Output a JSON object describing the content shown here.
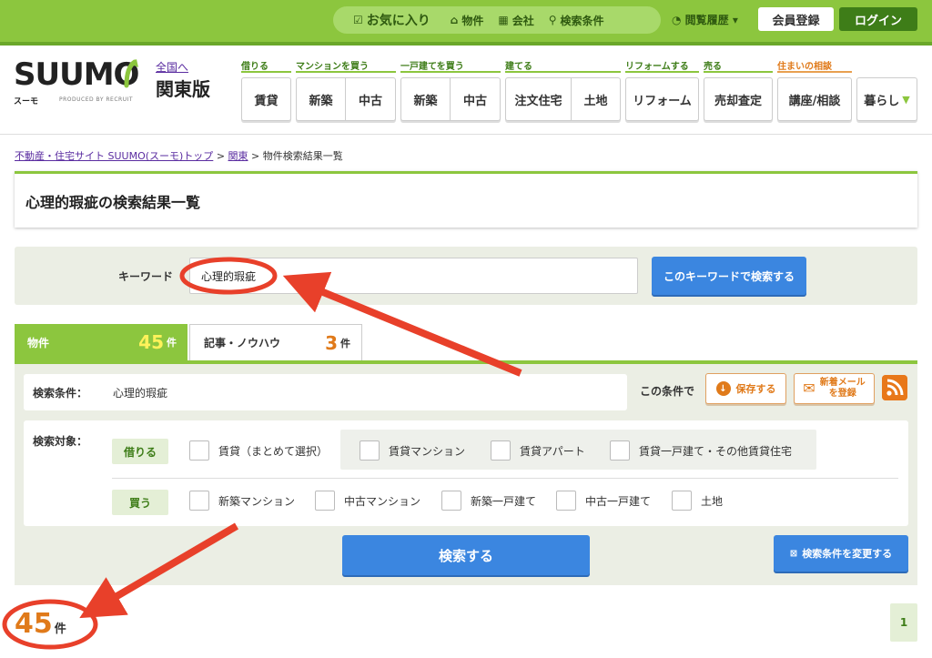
{
  "topbar": {
    "favorites": "お気に入り",
    "links": [
      "物件",
      "会社",
      "検索条件"
    ],
    "history": "閲覧履歴",
    "register": "会員登録",
    "login": "ログイン"
  },
  "header": {
    "logo_text": "SUUMO",
    "logo_sub": "スーモ",
    "logo_produced": "PRODUCED BY RECRUIT",
    "region_link": "全国へ",
    "region_name": "関東版",
    "nav": [
      {
        "label": "借りる",
        "buttons": [
          "賃貸"
        ]
      },
      {
        "label": "マンションを買う",
        "buttons": [
          "新築",
          "中古"
        ]
      },
      {
        "label": "一戸建てを買う",
        "buttons": [
          "新築",
          "中古"
        ]
      },
      {
        "label": "建てる",
        "buttons": [
          "注文住宅",
          "土地"
        ]
      },
      {
        "label": "リフォームする",
        "buttons": [
          "リフォーム"
        ]
      },
      {
        "label": "売る",
        "buttons": [
          "売却査定"
        ]
      },
      {
        "label": "住まいの相談",
        "buttons": [
          "講座/相談"
        ]
      },
      {
        "label": "",
        "buttons": [
          "暮らし"
        ]
      }
    ]
  },
  "breadcrumb": {
    "home": "不動産・住宅サイト SUUMO(スーモ)トップ",
    "region": "関東",
    "current": "物件検索結果一覧",
    "sep": ">"
  },
  "page_title": "心理的瑕疵の検索結果一覧",
  "keyword": {
    "label": "キーワード",
    "value": "心理的瑕疵",
    "button": "このキーワードで検索する"
  },
  "tabs": [
    {
      "name": "物件",
      "count": "45",
      "unit": "件"
    },
    {
      "name": "記事・ノウハウ",
      "count": "3",
      "unit": "件"
    }
  ],
  "conditions": {
    "label": "検索条件：",
    "value": "心理的瑕疵",
    "side_label": "この条件で",
    "save": "保存する",
    "mail_line1": "新着メール",
    "mail_line2": "を登録"
  },
  "target": {
    "label": "検索対象：",
    "rent_tag": "借りる",
    "rent_options": [
      "賃貸（まとめて選択）",
      "賃貸マンション",
      "賃貸アパート",
      "賃貸一戸建て・その他賃貸住宅"
    ],
    "buy_tag": "買う",
    "buy_options": [
      "新築マンション",
      "中古マンション",
      "新築一戸建て",
      "中古一戸建て",
      "土地"
    ]
  },
  "search_button": "検索する",
  "change_button": "検索条件を変更する",
  "result": {
    "count": "45",
    "unit": "件"
  },
  "pagination": {
    "current": "1"
  },
  "colors": {
    "brand_green": "#8cc63e",
    "dark_green": "#3e7d18",
    "blue_button": "#3b86e0",
    "orange": "#e07a1a",
    "annotation_red": "#e8402a"
  }
}
